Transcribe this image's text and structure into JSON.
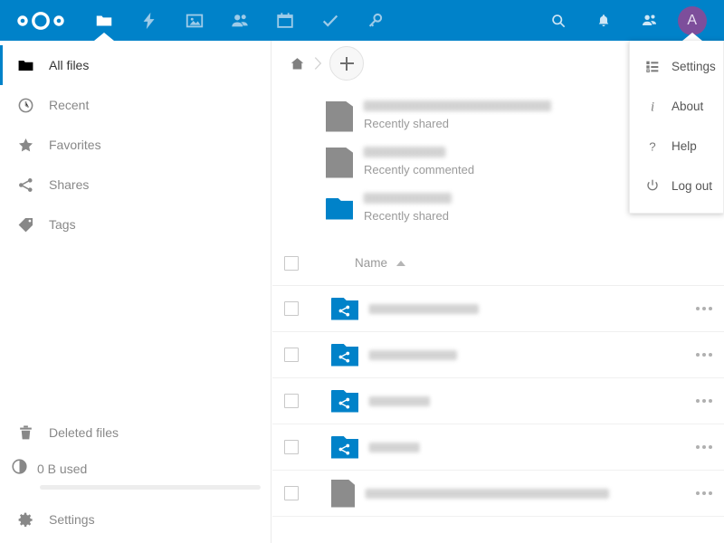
{
  "header": {
    "logo": "nextcloud-logo",
    "apps": [
      {
        "name": "files",
        "icon": "folder-icon",
        "label": "Files",
        "active": true
      },
      {
        "name": "activity",
        "icon": "lightning-icon",
        "label": "Activity",
        "active": false
      },
      {
        "name": "photos",
        "icon": "image-icon",
        "label": "Photos",
        "active": false
      },
      {
        "name": "contacts",
        "icon": "contacts-icon",
        "label": "Contacts",
        "active": false
      },
      {
        "name": "calendar",
        "icon": "calendar-icon",
        "label": "Calendar",
        "active": false
      },
      {
        "name": "tasks",
        "icon": "checkmark-icon",
        "label": "Tasks",
        "active": false
      },
      {
        "name": "passwords",
        "icon": "key-icon",
        "label": "Passwords",
        "active": false
      }
    ],
    "right": [
      {
        "name": "search",
        "icon": "search-icon",
        "label": "Search"
      },
      {
        "name": "notifications",
        "icon": "bell-icon",
        "label": "Notifications"
      },
      {
        "name": "contacts-menu",
        "icon": "contacts-icon",
        "label": "Contacts"
      }
    ],
    "avatar": {
      "initial": "A",
      "color": "#7d4e9b"
    },
    "accent_color": "#0082c9"
  },
  "user_menu": {
    "open": true,
    "items": [
      {
        "icon": "list-settings-icon",
        "label": "Settings"
      },
      {
        "icon": "info-icon",
        "label": "About"
      },
      {
        "icon": "question-icon",
        "label": "Help"
      },
      {
        "icon": "power-icon",
        "label": "Log out"
      }
    ]
  },
  "sidebar": {
    "top_items": [
      {
        "icon": "folder-icon",
        "label": "All files",
        "active": true
      },
      {
        "icon": "clock-icon",
        "label": "Recent",
        "active": false
      },
      {
        "icon": "star-icon",
        "label": "Favorites",
        "active": false
      },
      {
        "icon": "share-icon",
        "label": "Shares",
        "active": false
      },
      {
        "icon": "tag-icon",
        "label": "Tags",
        "active": false
      }
    ],
    "bottom_items": [
      {
        "icon": "trash-icon",
        "label": "Deleted files"
      },
      {
        "icon": "gear-icon",
        "label": "Settings"
      }
    ],
    "quota": {
      "icon": "pie-icon",
      "label": "0 B used",
      "percent": 0
    }
  },
  "breadcrumb": {
    "home_icon": "home-icon",
    "separator_icon": "chevron-right-icon",
    "new_button": {
      "icon": "plus-icon",
      "label": "New"
    }
  },
  "recommendations": [
    {
      "thumb": "file-thumb",
      "name_redacted": true,
      "name_width": 207,
      "subtitle": "Recently shared"
    },
    {
      "thumb": "file-thumb",
      "name_redacted": true,
      "name_width": 90,
      "subtitle": "Recently commented"
    },
    {
      "thumb": "folder-thumb",
      "name_redacted": true,
      "name_width": 97,
      "subtitle": "Recently shared"
    }
  ],
  "filetable": {
    "select_all_checked": false,
    "columns": [
      {
        "key": "name",
        "label": "Name",
        "sorted": "asc",
        "sort_icon": "triangle-up-icon"
      }
    ],
    "rows": [
      {
        "checked": false,
        "icon": "shared-folder-icon",
        "name_redacted": true,
        "name_width": 121,
        "actions_icon": "overflow-menu-icon"
      },
      {
        "checked": false,
        "icon": "shared-folder-icon",
        "name_redacted": true,
        "name_width": 97,
        "actions_icon": "overflow-menu-icon"
      },
      {
        "checked": false,
        "icon": "shared-folder-icon",
        "name_redacted": true,
        "name_width": 67,
        "actions_icon": "overflow-menu-icon"
      },
      {
        "checked": false,
        "icon": "shared-folder-icon",
        "name_redacted": true,
        "name_width": 56,
        "actions_icon": "overflow-menu-icon"
      },
      {
        "checked": false,
        "icon": "file-icon",
        "name_redacted": true,
        "name_width": 269,
        "actions_icon": "overflow-menu-icon"
      }
    ]
  }
}
